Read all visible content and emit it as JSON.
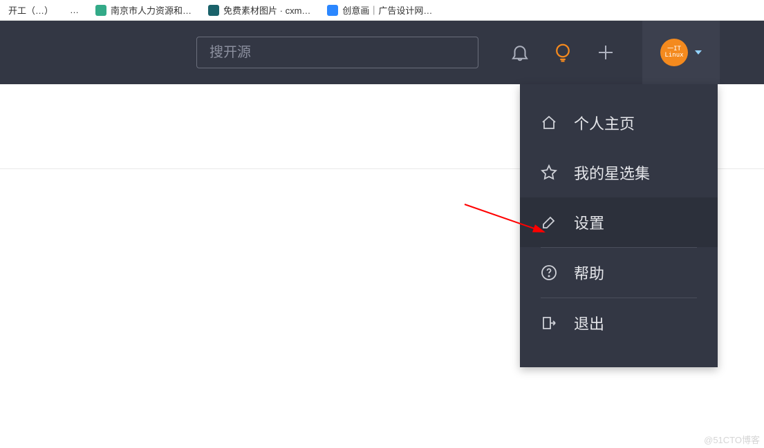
{
  "bookmarks": {
    "items": [
      {
        "label": "开工（…）",
        "color": ""
      },
      {
        "label": "…",
        "color": ""
      },
      {
        "label": "南京市人力资源和…",
        "color": "bm-green"
      },
      {
        "label": "免费素材图片 · cxm…",
        "color": "bm-dark"
      },
      {
        "label": "创意画｜广告设计网…",
        "color": "bm-blue"
      }
    ]
  },
  "header": {
    "search_placeholder": "搜开源",
    "avatar_text": "一IT\nLinux"
  },
  "dropdown": {
    "items": [
      {
        "id": "profile",
        "label": "个人主页"
      },
      {
        "id": "stars",
        "label": "我的星选集"
      },
      {
        "id": "settings",
        "label": "设置"
      },
      {
        "id": "help",
        "label": "帮助"
      },
      {
        "id": "logout",
        "label": "退出"
      }
    ]
  },
  "watermark": "@51CTO博客"
}
